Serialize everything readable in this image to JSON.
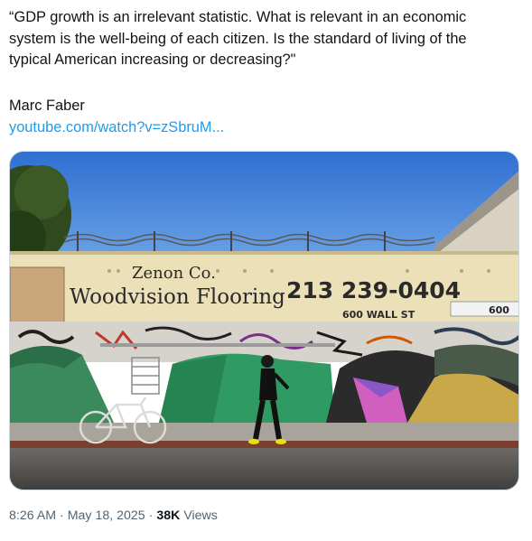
{
  "tweet": {
    "text_lines": [
      "“GDP growth is an irrelevant statistic. What is relevant in an economic",
      "system is the well-being of each citizen. Is the standard of living of the",
      "typical American increasing or decreasing?\""
    ],
    "author": "Marc Faber",
    "link_text": "youtube.com/watch?v=zSbruM..."
  },
  "image": {
    "sign_company": "Zenon Co.",
    "sign_title": "Woodvision Flooring",
    "sign_phone": "213 239-0404",
    "sign_address": "600 WALL ST",
    "sign_number": "600"
  },
  "meta": {
    "time": "8:26 AM",
    "separator1": "·",
    "date": "May 18, 2025",
    "separator2": "·",
    "views_count": "38K",
    "views_label": "Views"
  },
  "colors": {
    "link": "#1d9bf0",
    "text": "#0f1419",
    "secondary": "#536471",
    "sky": "#3a7ad6",
    "wall": "#ece0b8",
    "tarp_green": "#2f8a5a"
  }
}
